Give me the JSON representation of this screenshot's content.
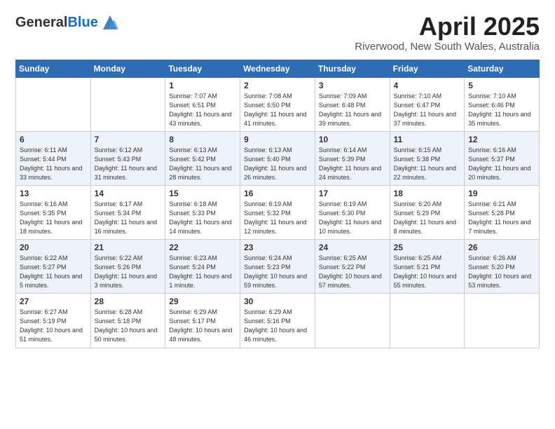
{
  "header": {
    "logo_general": "General",
    "logo_blue": "Blue",
    "month": "April 2025",
    "location": "Riverwood, New South Wales, Australia"
  },
  "days_of_week": [
    "Sunday",
    "Monday",
    "Tuesday",
    "Wednesday",
    "Thursday",
    "Friday",
    "Saturday"
  ],
  "weeks": [
    [
      {
        "day": "",
        "info": ""
      },
      {
        "day": "",
        "info": ""
      },
      {
        "day": "1",
        "info": "Sunrise: 7:07 AM\nSunset: 6:51 PM\nDaylight: 11 hours and 43 minutes."
      },
      {
        "day": "2",
        "info": "Sunrise: 7:08 AM\nSunset: 6:50 PM\nDaylight: 11 hours and 41 minutes."
      },
      {
        "day": "3",
        "info": "Sunrise: 7:09 AM\nSunset: 6:48 PM\nDaylight: 11 hours and 39 minutes."
      },
      {
        "day": "4",
        "info": "Sunrise: 7:10 AM\nSunset: 6:47 PM\nDaylight: 11 hours and 37 minutes."
      },
      {
        "day": "5",
        "info": "Sunrise: 7:10 AM\nSunset: 6:46 PM\nDaylight: 11 hours and 35 minutes."
      }
    ],
    [
      {
        "day": "6",
        "info": "Sunrise: 6:11 AM\nSunset: 5:44 PM\nDaylight: 11 hours and 33 minutes."
      },
      {
        "day": "7",
        "info": "Sunrise: 6:12 AM\nSunset: 5:43 PM\nDaylight: 11 hours and 31 minutes."
      },
      {
        "day": "8",
        "info": "Sunrise: 6:13 AM\nSunset: 5:42 PM\nDaylight: 11 hours and 28 minutes."
      },
      {
        "day": "9",
        "info": "Sunrise: 6:13 AM\nSunset: 5:40 PM\nDaylight: 11 hours and 26 minutes."
      },
      {
        "day": "10",
        "info": "Sunrise: 6:14 AM\nSunset: 5:39 PM\nDaylight: 11 hours and 24 minutes."
      },
      {
        "day": "11",
        "info": "Sunrise: 6:15 AM\nSunset: 5:38 PM\nDaylight: 11 hours and 22 minutes."
      },
      {
        "day": "12",
        "info": "Sunrise: 6:16 AM\nSunset: 5:37 PM\nDaylight: 11 hours and 20 minutes."
      }
    ],
    [
      {
        "day": "13",
        "info": "Sunrise: 6:16 AM\nSunset: 5:35 PM\nDaylight: 11 hours and 18 minutes."
      },
      {
        "day": "14",
        "info": "Sunrise: 6:17 AM\nSunset: 5:34 PM\nDaylight: 11 hours and 16 minutes."
      },
      {
        "day": "15",
        "info": "Sunrise: 6:18 AM\nSunset: 5:33 PM\nDaylight: 11 hours and 14 minutes."
      },
      {
        "day": "16",
        "info": "Sunrise: 6:19 AM\nSunset: 5:32 PM\nDaylight: 11 hours and 12 minutes."
      },
      {
        "day": "17",
        "info": "Sunrise: 6:19 AM\nSunset: 5:30 PM\nDaylight: 11 hours and 10 minutes."
      },
      {
        "day": "18",
        "info": "Sunrise: 6:20 AM\nSunset: 5:29 PM\nDaylight: 11 hours and 8 minutes."
      },
      {
        "day": "19",
        "info": "Sunrise: 6:21 AM\nSunset: 5:28 PM\nDaylight: 11 hours and 7 minutes."
      }
    ],
    [
      {
        "day": "20",
        "info": "Sunrise: 6:22 AM\nSunset: 5:27 PM\nDaylight: 11 hours and 5 minutes."
      },
      {
        "day": "21",
        "info": "Sunrise: 6:22 AM\nSunset: 5:26 PM\nDaylight: 11 hours and 3 minutes."
      },
      {
        "day": "22",
        "info": "Sunrise: 6:23 AM\nSunset: 5:24 PM\nDaylight: 11 hours and 1 minute."
      },
      {
        "day": "23",
        "info": "Sunrise: 6:24 AM\nSunset: 5:23 PM\nDaylight: 10 hours and 59 minutes."
      },
      {
        "day": "24",
        "info": "Sunrise: 6:25 AM\nSunset: 5:22 PM\nDaylight: 10 hours and 57 minutes."
      },
      {
        "day": "25",
        "info": "Sunrise: 6:25 AM\nSunset: 5:21 PM\nDaylight: 10 hours and 55 minutes."
      },
      {
        "day": "26",
        "info": "Sunrise: 6:26 AM\nSunset: 5:20 PM\nDaylight: 10 hours and 53 minutes."
      }
    ],
    [
      {
        "day": "27",
        "info": "Sunrise: 6:27 AM\nSunset: 5:19 PM\nDaylight: 10 hours and 51 minutes."
      },
      {
        "day": "28",
        "info": "Sunrise: 6:28 AM\nSunset: 5:18 PM\nDaylight: 10 hours and 50 minutes."
      },
      {
        "day": "29",
        "info": "Sunrise: 6:29 AM\nSunset: 5:17 PM\nDaylight: 10 hours and 48 minutes."
      },
      {
        "day": "30",
        "info": "Sunrise: 6:29 AM\nSunset: 5:16 PM\nDaylight: 10 hours and 46 minutes."
      },
      {
        "day": "",
        "info": ""
      },
      {
        "day": "",
        "info": ""
      },
      {
        "day": "",
        "info": ""
      }
    ]
  ]
}
